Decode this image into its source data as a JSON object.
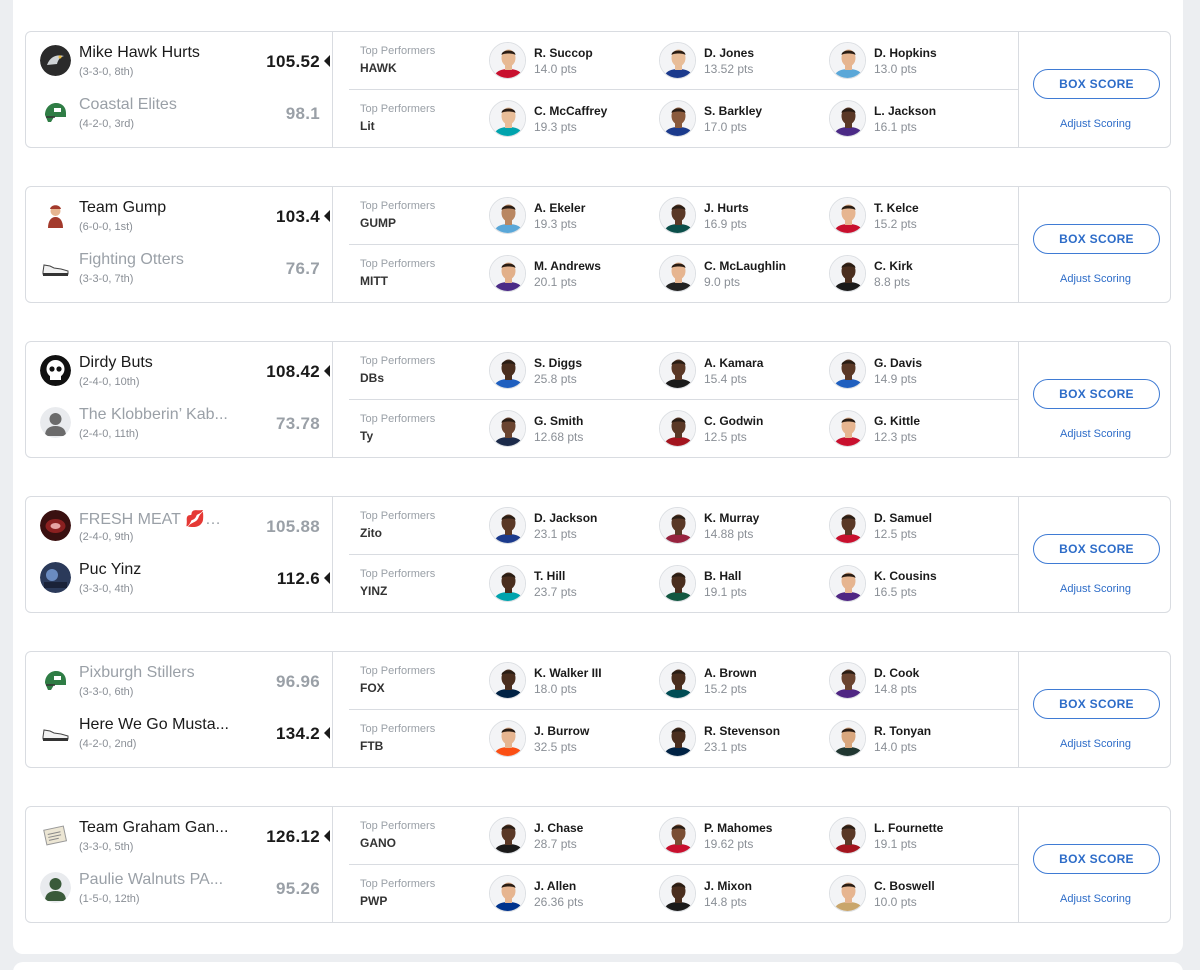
{
  "labels": {
    "top_performers": "Top Performers",
    "box_score": "BOX SCORE",
    "adjust_scoring": "Adjust Scoring"
  },
  "colors": {
    "accent": "#2d6cc8",
    "loser_text": "#9aa0a7",
    "border": "#d9dce1"
  },
  "matchups": [
    {
      "teams": [
        {
          "name": "Mike Hawk Hurts",
          "record": "(3-3-0, 8th)",
          "score": "105.52",
          "winner": true,
          "avatar": "hawk-avatar-icon",
          "avatar_color": "#2b2b2b"
        },
        {
          "name": "Coastal Elites",
          "record": "(4-2-0, 3rd)",
          "score": "98.1",
          "winner": false,
          "avatar": "green-helmet-icon",
          "avatar_color": "#2f7d45"
        }
      ],
      "performers": [
        {
          "abbr": "HAWK",
          "players": [
            {
              "name": "R. Succop",
              "pts": "14.0 pts",
              "jersey": "#c8102e",
              "skin": "#e7b993"
            },
            {
              "name": "D. Jones",
              "pts": "13.52 pts",
              "jersey": "#1b3a8c",
              "skin": "#e8bd98"
            },
            {
              "name": "D. Hopkins",
              "pts": "13.0 pts",
              "jersey": "#5aa7d8",
              "skin": "#e6b590"
            }
          ]
        },
        {
          "abbr": "Lit",
          "players": [
            {
              "name": "C. McCaffrey",
              "pts": "19.3 pts",
              "jersey": "#00a3ad",
              "skin": "#e8bd98"
            },
            {
              "name": "S. Barkley",
              "pts": "17.0 pts",
              "jersey": "#1b3a8c",
              "skin": "#8a5a3c"
            },
            {
              "name": "L. Jackson",
              "pts": "16.1 pts",
              "jersey": "#4b2a86",
              "skin": "#5a3826"
            }
          ]
        }
      ]
    },
    {
      "teams": [
        {
          "name": "Team Gump",
          "record": "(6-0-0, 1st)",
          "score": "103.4",
          "winner": true,
          "avatar": "gump-avatar-icon",
          "avatar_color": "#a33a2c"
        },
        {
          "name": "Fighting Otters",
          "record": "(3-3-0, 7th)",
          "score": "76.7",
          "winner": false,
          "avatar": "sneaker-icon",
          "avatar_color": "#555555"
        }
      ],
      "performers": [
        {
          "abbr": "GUMP",
          "players": [
            {
              "name": "A. Ekeler",
              "pts": "19.3 pts",
              "jersey": "#5aa7d8",
              "skin": "#b98762"
            },
            {
              "name": "J. Hurts",
              "pts": "16.9 pts",
              "jersey": "#0b4f4a",
              "skin": "#5a3826"
            },
            {
              "name": "T. Kelce",
              "pts": "15.2 pts",
              "jersey": "#c8102e",
              "skin": "#e6b590"
            }
          ]
        },
        {
          "abbr": "MITT",
          "players": [
            {
              "name": "M. Andrews",
              "pts": "20.1 pts",
              "jersey": "#4b2a86",
              "skin": "#e2b08a"
            },
            {
              "name": "C. McLaughlin",
              "pts": "9.0 pts",
              "jersey": "#222222",
              "skin": "#e6b590"
            },
            {
              "name": "C. Kirk",
              "pts": "8.8 pts",
              "jersey": "#1a1a1a",
              "skin": "#4a2e1e"
            }
          ]
        }
      ]
    },
    {
      "teams": [
        {
          "name": "Dirdy Buts",
          "record": "(2-4-0, 10th)",
          "score": "108.42",
          "winner": true,
          "avatar": "skull-icon",
          "avatar_color": "#111111"
        },
        {
          "name": "The Klobberin’ Kab...",
          "record": "(2-4-0, 11th)",
          "score": "73.78",
          "winner": false,
          "avatar": "person-avatar-icon",
          "avatar_color": "#6b6b6b"
        }
      ],
      "performers": [
        {
          "abbr": "DBs",
          "players": [
            {
              "name": "S. Diggs",
              "pts": "25.8 pts",
              "jersey": "#1f5fbf",
              "skin": "#4a2e1e"
            },
            {
              "name": "A. Kamara",
              "pts": "15.4 pts",
              "jersey": "#1a1a1a",
              "skin": "#5a3826"
            },
            {
              "name": "G. Davis",
              "pts": "14.9 pts",
              "jersey": "#1f5fbf",
              "skin": "#5a3826"
            }
          ]
        },
        {
          "abbr": "Ty",
          "players": [
            {
              "name": "G. Smith",
              "pts": "12.68 pts",
              "jersey": "#1b2a4a",
              "skin": "#6a4430"
            },
            {
              "name": "C. Godwin",
              "pts": "12.5 pts",
              "jersey": "#a3141e",
              "skin": "#5a3826"
            },
            {
              "name": "G. Kittle",
              "pts": "12.3 pts",
              "jersey": "#c8102e",
              "skin": "#e6b590"
            }
          ]
        }
      ]
    },
    {
      "teams": [
        {
          "name": "FRESH MEAT 💋💋...",
          "record": "(2-4-0, 9th)",
          "score": "105.88",
          "winner": false,
          "avatar": "meat-avatar-icon",
          "avatar_color": "#8b2020"
        },
        {
          "name": "Puc Yinz",
          "record": "(3-3-0, 4th)",
          "score": "112.6",
          "winner": true,
          "avatar": "puc-avatar-icon",
          "avatar_color": "#2b3a5a"
        }
      ],
      "performers": [
        {
          "abbr": "Zito",
          "players": [
            {
              "name": "D. Jackson",
              "pts": "23.1 pts",
              "jersey": "#1b3a8c",
              "skin": "#5a3826"
            },
            {
              "name": "K. Murray",
              "pts": "14.88 pts",
              "jersey": "#97233f",
              "skin": "#5a3826"
            },
            {
              "name": "D. Samuel",
              "pts": "12.5 pts",
              "jersey": "#c8102e",
              "skin": "#5a3826"
            }
          ]
        },
        {
          "abbr": "YINZ",
          "players": [
            {
              "name": "T. Hill",
              "pts": "23.7 pts",
              "jersey": "#00a3ad",
              "skin": "#4a2e1e"
            },
            {
              "name": "B. Hall",
              "pts": "19.1 pts",
              "jersey": "#125740",
              "skin": "#4a2e1e"
            },
            {
              "name": "K. Cousins",
              "pts": "16.5 pts",
              "jersey": "#4f2683",
              "skin": "#e6b590"
            }
          ]
        }
      ]
    },
    {
      "teams": [
        {
          "name": "Pixburgh Stillers",
          "record": "(3-3-0, 6th)",
          "score": "96.96",
          "winner": false,
          "avatar": "green-helmet-icon",
          "avatar_color": "#2f7d45"
        },
        {
          "name": "Here We Go Musta...",
          "record": "(4-2-0, 2nd)",
          "score": "134.2",
          "winner": true,
          "avatar": "sneaker-icon",
          "avatar_color": "#555555"
        }
      ],
      "performers": [
        {
          "abbr": "FOX",
          "players": [
            {
              "name": "K. Walker III",
              "pts": "18.0 pts",
              "jersey": "#002244",
              "skin": "#4a2e1e"
            },
            {
              "name": "A. Brown",
              "pts": "15.2 pts",
              "jersey": "#004c54",
              "skin": "#4a2e1e"
            },
            {
              "name": "D. Cook",
              "pts": "14.8 pts",
              "jersey": "#4f2683",
              "skin": "#6a4430"
            }
          ]
        },
        {
          "abbr": "FTB",
          "players": [
            {
              "name": "J. Burrow",
              "pts": "32.5 pts",
              "jersey": "#fb4f14",
              "skin": "#e6b590"
            },
            {
              "name": "R. Stevenson",
              "pts": "23.1 pts",
              "jersey": "#002244",
              "skin": "#4a2e1e"
            },
            {
              "name": "R. Tonyan",
              "pts": "14.0 pts",
              "jersey": "#203731",
              "skin": "#d9a77e"
            }
          ]
        }
      ]
    },
    {
      "teams": [
        {
          "name": "Team Graham Gan...",
          "record": "(3-3-0, 5th)",
          "score": "126.12",
          "winner": true,
          "avatar": "paper-avatar-icon",
          "avatar_color": "#c9c2ad"
        },
        {
          "name": "Paulie Walnuts PA...",
          "record": "(1-5-0, 12th)",
          "score": "95.26",
          "winner": false,
          "avatar": "person-avatar-icon",
          "avatar_color": "#3a5a3a"
        }
      ],
      "performers": [
        {
          "abbr": "GANO",
          "players": [
            {
              "name": "J. Chase",
              "pts": "28.7 pts",
              "jersey": "#1a1a1a",
              "skin": "#5a3826"
            },
            {
              "name": "P. Mahomes",
              "pts": "19.62 pts",
              "jersey": "#c8102e",
              "skin": "#7a4e34"
            },
            {
              "name": "L. Fournette",
              "pts": "19.1 pts",
              "jersey": "#a3141e",
              "skin": "#5a3826"
            }
          ]
        },
        {
          "abbr": "PWP",
          "players": [
            {
              "name": "J. Allen",
              "pts": "26.36 pts",
              "jersey": "#00338d",
              "skin": "#e6b590"
            },
            {
              "name": "J. Mixon",
              "pts": "14.8 pts",
              "jersey": "#1a1a1a",
              "skin": "#4a2e1e"
            },
            {
              "name": "C. Boswell",
              "pts": "10.0 pts",
              "jersey": "#c9a66b",
              "skin": "#e6b590"
            }
          ]
        }
      ]
    }
  ]
}
